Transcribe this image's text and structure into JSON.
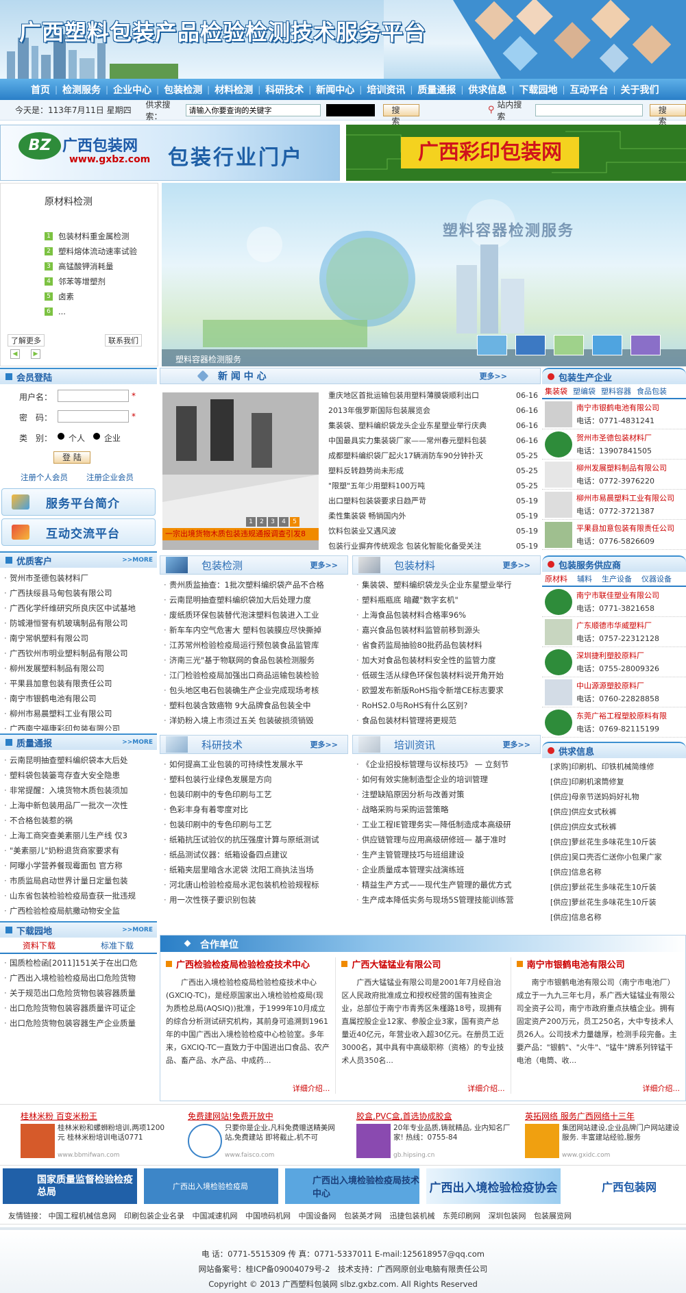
{
  "header": {
    "title": "广西塑料包装产品检验检测技术服务平台"
  },
  "nav": [
    "首页",
    "检测服务",
    "企业中心",
    "包装检测",
    "材料检测",
    "科研技术",
    "新闻中心",
    "培训资讯",
    "质量通报",
    "供求信息",
    "下载园地",
    "互动平台",
    "关于我们"
  ],
  "topbar": {
    "today": "今天是：113年7月11日 星期四",
    "supply_search_label": "供求搜索：",
    "search_placeholder": "请输入你要查询的关键字",
    "search_btn": "搜 索",
    "site_search_label": "站内搜索",
    "site_search_btn": "搜 索"
  },
  "banners": {
    "left_site": "广西包装网",
    "left_url": "www.gxbz.com",
    "left_slogan": "包装行业门户",
    "right_title": "广西彩印包装网"
  },
  "raw": {
    "title": "原材料检测",
    "items": [
      "包装材料重金属检测",
      "塑料熔体流动速率试验",
      "高锰酸钾消耗量",
      "邻苯等增塑剂",
      "卤素",
      "..."
    ],
    "nums": [
      "1",
      "2",
      "3",
      "4",
      "5",
      "6"
    ],
    "more": "了解更多",
    "contact": "联系我们"
  },
  "slide": {
    "title": "塑料容器检测服务",
    "caption": "塑料容器检测服务"
  },
  "member": {
    "title": "会员登陆",
    "user": "用户名：",
    "pwd": "密　码：",
    "type": "类　别：",
    "personal": "个人",
    "company": "企业",
    "login": "登 陆",
    "reg_p": "注册个人会员",
    "reg_c": "注册企业会员",
    "intro_btn": "服务平台简介",
    "interact_btn": "互动交流平台"
  },
  "clients": {
    "title": "优质客户",
    "more": ">>MORE",
    "items": [
      "贺州市圣德包装材料厂",
      "广西扶绥县马甸包装有限公司",
      "广西化学纤维研究所良庆区中试基地",
      "防城港恒誉有机玻璃制品有限公司",
      "南宁常帆塑料有限公司",
      "广西钦州市明业塑料制品有限公司",
      "柳州发展塑料制品有限公司",
      "平果县加意包装有限责任公司",
      "南宁市银鹤电池有限公司",
      "柳州市易晨塑料工业有限公司",
      "广西南宁福康彩印包装有限公司"
    ]
  },
  "quality": {
    "title": "质量通报",
    "more": ">>MORE",
    "items": [
      "云南昆明抽查塑料编织袋本大后处",
      "塑料袋包装篓弯存查大安全隐患",
      "非常提醒：入境货物木质包装须加",
      "上海中新包装用品厂一批次一次性",
      "不合格包装惹的祸",
      "上海工商突查美素丽儿生产线 仅3",
      "\"美素丽儿\"奶粉退货商家要求有",
      "阿曝小学营养餐现霉面包 官方称",
      "市质监局启动世界计量日定量包装",
      "山东省包装检验检疫局查获一批违规",
      "广西检验检疫局航撒动物安全监"
    ]
  },
  "download": {
    "title": "下载园地",
    "more": ">>MORE",
    "tab1": "资料下载",
    "tab2": "标准下载",
    "items": [
      "国质检检函[2011]151关于在出口危",
      "广西出入境检验检疫局出口危险货物",
      "关于规范出口危险货物包装容器质量",
      "出口危险货物包装容器质量许可证企",
      "出口危险货物包装容器生产企业质量"
    ]
  },
  "news": {
    "title": "新 闻 中 心",
    "more": "更多>>",
    "caption": "一宗出境货物木质包装违规通报调查引发8",
    "pages": [
      "1",
      "2",
      "3",
      "4",
      "5"
    ],
    "items": [
      {
        "t": "重庆地区首批运输包装用塑料薄膜袋顺利出口",
        "d": "06-16"
      },
      {
        "t": "2013年俄罗斯国际包装展览会",
        "d": "06-16"
      },
      {
        "t": "集装袋、塑料编织袋龙头企业东星塑业举行庆典",
        "d": "06-16"
      },
      {
        "t": "中国最具实力集装袋厂家——常州春元塑料包装",
        "d": "06-16"
      },
      {
        "t": "成都塑料编织袋厂起火17辆消防车90分钟扑灭",
        "d": "05-25"
      },
      {
        "t": "塑料反转趋势尚未形成",
        "d": "05-25"
      },
      {
        "t": "\"限塑\"五年少用塑料100万吨",
        "d": "05-25"
      },
      {
        "t": "出口塑料包装袋要求日趋严苛",
        "d": "05-19"
      },
      {
        "t": "柔性集装袋 畅销国内外",
        "d": "05-19"
      },
      {
        "t": "饮料包装业又遇风波",
        "d": "05-19"
      },
      {
        "t": "包装行业摒弃传统观念 包装化智能化备受关注",
        "d": "05-19"
      }
    ]
  },
  "pack_test": {
    "title": "包装检测",
    "more": "更多>>",
    "items": [
      "贵州质监抽查：1批次塑料编织袋产品不合格",
      "云南昆明抽查塑料编织袋加大后处理力度",
      "废纸质环保包装替代泡沫塑料包装进入工业",
      "新车车内空气危害大 塑料包装膜应尽快撕掉",
      "江苏常州检验检疫局运行预包装食品监管库",
      "济南三光\"基于物联网的食品包装检测服务",
      "江门检验检疫局加强出口商品运输包装检验",
      "包头地区电石包装确生产企业完成现场考核",
      "塑料包装含致癌物 9大品牌食品包装全中",
      "洋奶粉入境上市须过五关 包装破损须销毁"
    ]
  },
  "pack_mat": {
    "title": "包装材料",
    "more": "更多>>",
    "items": [
      "集装袋、塑料编织袋龙头企业东星塑业举行",
      "塑料瓶瓶底 暗藏\"数字玄机\"",
      "上海食品包装材料合格率96%",
      "嘉兴食品包装材料监管前移到源头",
      "省食药监局抽验80批药品包装材料",
      "加大对食品包装材料安全性的监管力度",
      "低碳生活从绿色环保包装材料说开角开始",
      "欧盟发布新版RoHS指令新增CE标志要求",
      "RoHS2.0与RoHS有什么区别?",
      "食品包装材料管理将更规范"
    ]
  },
  "research": {
    "title": "科研技术",
    "more": "更多>>",
    "items": [
      "如何提高工业包装的可持续性发展水平",
      "塑料包装行业绿色发展是方向",
      "包装印刷中的专色印刷与工艺",
      "色彩丰身有着零度对比",
      "包装印刷中的专色印刷与工艺",
      "纸箱抗压试验仪的抗压强度计算与原纸测试",
      "纸品测试仪器：纸箱设备四点建议",
      "纸箱夹层里暗含水泥袋 沈阳工商执法当场",
      "河北唐山检验检疫局水泥包装机检验规程标",
      "用一次性筷子要识别包装"
    ]
  },
  "training": {
    "title": "培训资讯",
    "more": "更多>>",
    "items": [
      "《企业招投标管理与议标技巧》 — 立刻节",
      "如何有效实施制造型企业的培训管理",
      "注塑缺陷原因分析与改善对策",
      "战略采购与采购运营策略",
      "工业工程IE管理务实—降低制造成本高级研",
      "供应链管理与应用高级研修班— 基于准时",
      "生产主管管理技巧与班组建设",
      "企业质量成本管理实战演练班",
      "精益生产方式——现代生产管理的最优方式",
      "生产成本降低实务与现场5S管理技能训练营"
    ]
  },
  "partners": {
    "title": "合作单位",
    "more": "详细介绍...",
    "items": [
      {
        "name": "广西检验检疫局检验检疫技术中心",
        "desc": "广西出入境检验检疫局检验检疫技术中心(GXCIQ-TC)，是经原国家出入境检验检疫局(现为质检总局(AQSIQ))批准，于1999年10月成立的综合分析测试研究机构，其前身可追溯到1961年的中国广西出入境检验检疫中心检验室。多年来，GXCIQ-TC一直致力于中国进出口食品、农产品、畜产品、水产品、中成药..."
      },
      {
        "name": "广西大锰锰业有限公司",
        "desc": "广西大锰锰业有限公司是2001年7月经自治区人民政府批准成立和授权经营的国有独资企业，总部位于南宁市青秀区朱槿路18号，现拥有直属控股企业12家、参股企业3家，国有资产总量近40亿元，年营业收入超30亿元。在册员工近3000名，其中具有中高级职称（资格）的专业技术人员350名..."
      },
      {
        "name": "南宁市银鹤电池有限公司",
        "desc": "南宁市银鹤电池有限公司（南宁市电池厂）成立于一九九三年七月，系广西大锰锰业有限公司全资子公司，南宁市政府重点扶植企业。拥有固定资产200万元，员工250名，大中专技术人员26人。公司技术力量雄厚，检测手段完备。主要产品：\"银鹤\"、\"火牛\"、\"锰牛\"牌系列锌锰干电池（电筒、收..."
      }
    ]
  },
  "producers": {
    "title": "包装生产企业",
    "tabs": [
      "集装袋",
      "塑编袋",
      "塑料容器",
      "食品包装"
    ],
    "items": [
      {
        "name": "南宁市银鹤电池有限公司",
        "tel": "电话：0771-4831241"
      },
      {
        "name": "贺州市圣德包装材料厂",
        "tel": "电话：13907841505"
      },
      {
        "name": "柳州发展塑料制品有限公司",
        "tel": "电话：0772-3976220"
      },
      {
        "name": "柳州市易晨塑料工业有限公司",
        "tel": "电话：0772-3721387"
      },
      {
        "name": "平果县加意包装有限责任公司",
        "tel": "电话：0776-5826609"
      }
    ]
  },
  "suppliers": {
    "title": "包装服务供应商",
    "tabs": [
      "原材料",
      "辅料",
      "生产设备",
      "仪器设备"
    ],
    "items": [
      {
        "name": "南宁市联佳塑业有限公司",
        "tel": "电话：0771-3821658"
      },
      {
        "name": "广东顺德市华威塑料厂",
        "tel": "电话：0757-22312128"
      },
      {
        "name": "深圳捷利塑胶原料厂",
        "tel": "电话：0755-28009326"
      },
      {
        "name": "中山源源塑胶原料厂",
        "tel": "电话：0760-22828858"
      },
      {
        "name": "东莞广裕工程塑胶原料有限",
        "tel": "电话：0769-82115199"
      }
    ]
  },
  "supply": {
    "title": "供求信息",
    "items": [
      "[求购]印刷机、印铁机械简维修",
      "[供应]印刷机滚筒修复",
      "[供应]母亲节送妈妈好礼物",
      "[供应]供应女式秋裤",
      "[供应]供应女式秋裤",
      "[供应]萝丝花生多味花生10斤装",
      "[供应]吴口壳否仁送你小包果广家",
      "[供应]信息名称",
      "[供应]萝丝花生多味花生10斤装",
      "[供应]萝丝花生多味花生10斤装",
      "[供应]信息名称"
    ]
  },
  "ads": [
    {
      "title": "桂林米粉 百变米粉王",
      "desc": "桂林米粉和螺蛳粉培训,两项1200元 桂林米粉培训电话0771",
      "url": "www.bbmifwan.com"
    },
    {
      "title": "免费建网站!免费开放中",
      "desc": "只要你是企业,凡科免费赠送精美网站,免费建站 即将截止,机不可",
      "url": "www.faisco.com"
    },
    {
      "title": "胶盒,PVC盒,首选协成胶盒",
      "desc": "20年专业品质,铸就精品, 业内知名厂家! 热线：0755-84",
      "url": "gb.hipsing.cn"
    },
    {
      "title": "英拓网络 服务广西网络十三年",
      "desc": "集团网站建设,企业品牌门户网站建设服务. 丰富建站经验,服务",
      "url": "www.gxidc.com"
    }
  ],
  "logos": [
    "国家质量监督检验检疫总局",
    "广西出入境检验检疫局",
    "广西出入境检验检疫局技术中心",
    "广西出入境检验检疫协会",
    "广西包装网"
  ],
  "friend": {
    "label": "友情链接：",
    "items": [
      "中国工程机械信息网",
      "印刷包装企业名录",
      "中国减速机网",
      "中国喷码机网",
      "中国设备网",
      "包装英才网",
      "迅捷包装机械",
      "东莞印刷网",
      "深圳包装网",
      "包装展览网"
    ]
  },
  "footer": {
    "line1": "电 话：0771-5515309 传 真：0771-5337011 E-mail:125618957@qq.com",
    "line2": "网站备案号：桂ICP备09004079号-2　技术支持：广西网原创业电脑有限责任公司",
    "line3": "Copyright © 2013 广西塑料包装网 slbz.gxbz.com. All Rights Reserved"
  },
  "colors": {
    "nav": "#2a7fc7",
    "accent_red": "#cc0000",
    "section_blue": "#1e5fa6"
  }
}
